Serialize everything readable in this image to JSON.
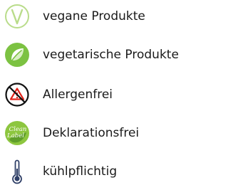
{
  "items": [
    {
      "label": "vegane Produkte",
      "icon": "vegan-v-icon",
      "color": "#b9dc8a"
    },
    {
      "label": "vegetarische Produkte",
      "icon": "leaf-icon",
      "color": "#7cc242"
    },
    {
      "label": "Allergenfrei",
      "icon": "allergen-free-icon",
      "color": "#e2231a"
    },
    {
      "label": "Deklarationsfrei",
      "icon": "clean-label-icon",
      "color": "#8dc63f",
      "icon_text": [
        "Clean",
        "Label"
      ]
    },
    {
      "label": "kühlpflichtig",
      "icon": "thermometer-icon",
      "color": "#2f3f67"
    }
  ]
}
